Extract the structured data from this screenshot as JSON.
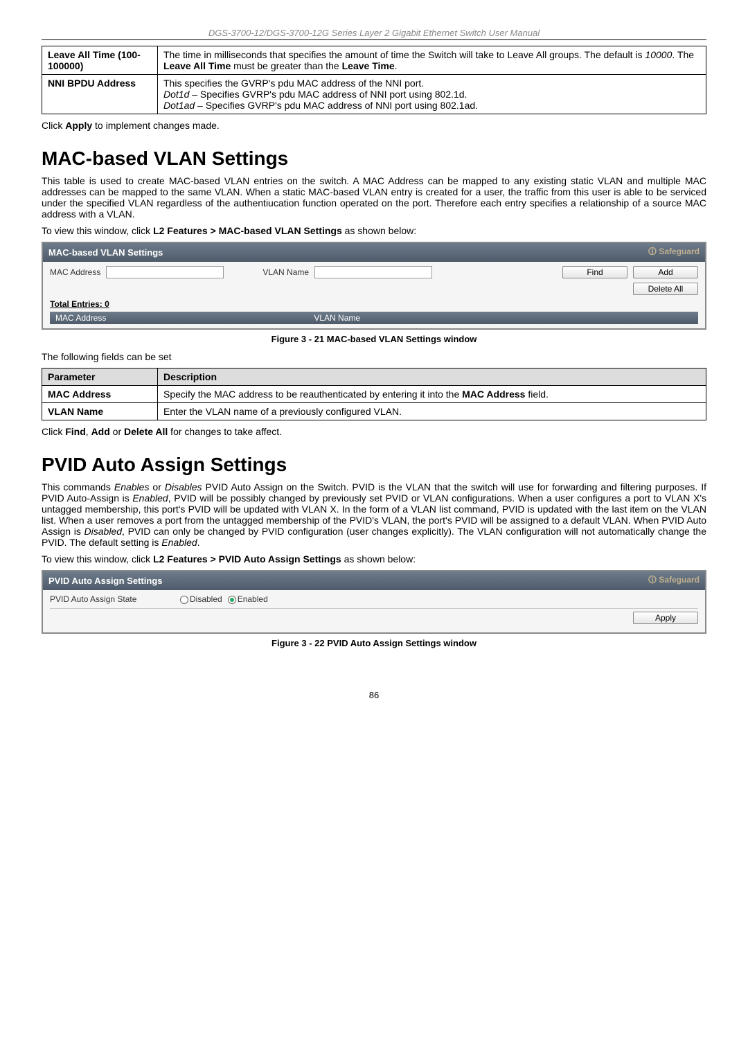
{
  "header": "DGS-3700-12/DGS-3700-12G Series Layer 2 Gigabit Ethernet Switch User Manual",
  "table1": {
    "rows": [
      {
        "param": "Leave All Time (100-100000)",
        "desc_parts": [
          "The time in milliseconds that specifies the amount of time the Switch will take to Leave All groups. The default is ",
          "10000",
          ". The ",
          "Leave All Time",
          " must be greater than the ",
          "Leave Time",
          "."
        ]
      },
      {
        "param": "NNI BPDU Address",
        "desc_lines": {
          "l1": "This specifies the GVRP's pdu MAC address of the NNI port.",
          "l2a": "Dot1d",
          "l2b": " – Specifies GVRP's pdu MAC address of NNI port using 802.1d.",
          "l3a": "Dot1ad",
          "l3b": " – Specifies GVRP's pdu MAC address of NNI port using 802.1ad."
        }
      }
    ]
  },
  "click_apply": {
    "pre": "Click ",
    "b": "Apply",
    "post": " to implement changes made."
  },
  "section1": {
    "title": "MAC-based VLAN Settings",
    "para": "This table is used to create MAC-based VLAN entries on the switch. A MAC Address can be mapped to any existing static VLAN and multiple MAC addresses can be mapped to the same VLAN. When a static MAC-based VLAN entry is created for a user, the traffic from this user is able to be serviced under the specified VLAN regardless of the authentiucation function operated on the port. Therefore each entry specifies a relationship of a source MAC address with a VLAN.",
    "nav": {
      "pre": "To view this window, click ",
      "b": "L2 Features > MAC-based VLAN Settings",
      "post": " as shown below:"
    },
    "ui": {
      "title": "MAC-based VLAN Settings",
      "safeguard": "Safeguard",
      "mac_label": "MAC Address",
      "vlan_label": "VLAN Name",
      "find": "Find",
      "add": "Add",
      "delete_all": "Delete All",
      "total": "Total Entries: 0",
      "col1": "MAC Address",
      "col2": "VLAN Name"
    },
    "caption": "Figure 3 - 21 MAC-based VLAN Settings window",
    "fields_intro": "The following fields can be set",
    "param_header": "Parameter",
    "desc_header": "Description",
    "params": [
      {
        "name": "MAC Address",
        "desc_pre": "Specify the MAC address to be reauthenticated by entering it into the ",
        "desc_b": "MAC Address",
        "desc_post": " field."
      },
      {
        "name": "VLAN Name",
        "desc": "Enter the VLAN name of a previously configured VLAN."
      }
    ],
    "click_note": {
      "pre": "Click ",
      "b1": "Find",
      "m1": ", ",
      "b2": "Add",
      "m2": " or ",
      "b3": "Delete All",
      "post": " for changes to take affect."
    }
  },
  "section2": {
    "title": "PVID Auto Assign Settings",
    "para_parts": {
      "p1": "This commands ",
      "i1": "Enables",
      "p2": " or ",
      "i2": "Disables",
      "p3": " PVID Auto Assign on the Switch. PVID is the VLAN that the switch will use for forwarding and filtering purposes. If PVID Auto-Assign is ",
      "i3": "Enabled",
      "p4": ", PVID will be possibly changed by previously set PVID or VLAN configurations. When a user configures a port to VLAN X's untagged membership, this port's PVID will be updated with VLAN X. In the form of a VLAN list command, PVID is updated with the last item on the VLAN list. When a user removes a port from the untagged membership of the PVID's VLAN, the port's PVID will be assigned to a default VLAN. When PVID Auto Assign is ",
      "i4": "Disabled",
      "p5": ", PVID can only be changed by PVID configuration (user changes explicitly). The VLAN configuration will not automatically change the PVID. The default setting is ",
      "i5": "Enabled",
      "p6": "."
    },
    "nav": {
      "pre": "To view this window, click ",
      "b": "L2 Features > PVID Auto Assign Settings",
      "post": " as shown below:"
    },
    "ui": {
      "title": "PVID Auto Assign Settings",
      "safeguard": "Safeguard",
      "state_label": "PVID Auto Assign State",
      "disabled": "Disabled",
      "enabled": "Enabled",
      "apply": "Apply"
    },
    "caption": "Figure 3 - 22 PVID Auto Assign Settings window"
  },
  "page_number": "86"
}
